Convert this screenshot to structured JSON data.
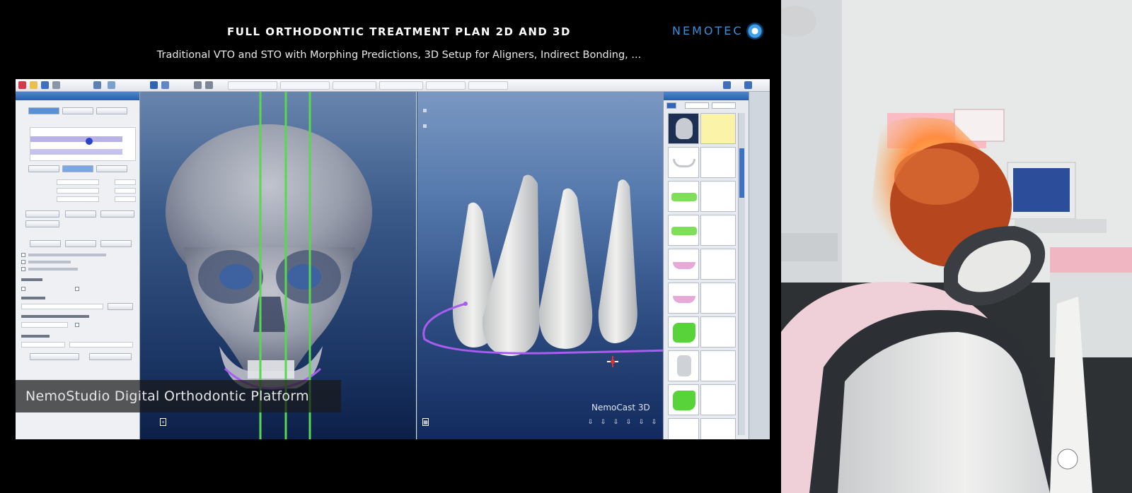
{
  "promo": {
    "title": "FULL ORTHODONTIC TREATMENT PLAN 2D AND 3D",
    "subtitle": "Traditional VTO and STO with Morphing Predictions, 3D Setup for Aligners, Indirect Bonding, ...",
    "brand": "NEMOTEC",
    "caption": "NemoStudio Digital Orthodontic Platform",
    "viewport_label": "NemoCast 3D"
  },
  "colors": {
    "guide_line": "#59d84f",
    "arch_curve": "#a85cf0",
    "accent_blue": "#2a5fa8",
    "selected_label": "#fbf3a8"
  },
  "icons": {
    "brand_logo": "nemotec-logo-icon",
    "viewport_tools": [
      "view-front-icon",
      "view-side-icon",
      "view-top-icon",
      "view-bottom-icon",
      "view-left-icon",
      "view-right-icon",
      "view-reset-icon"
    ]
  }
}
